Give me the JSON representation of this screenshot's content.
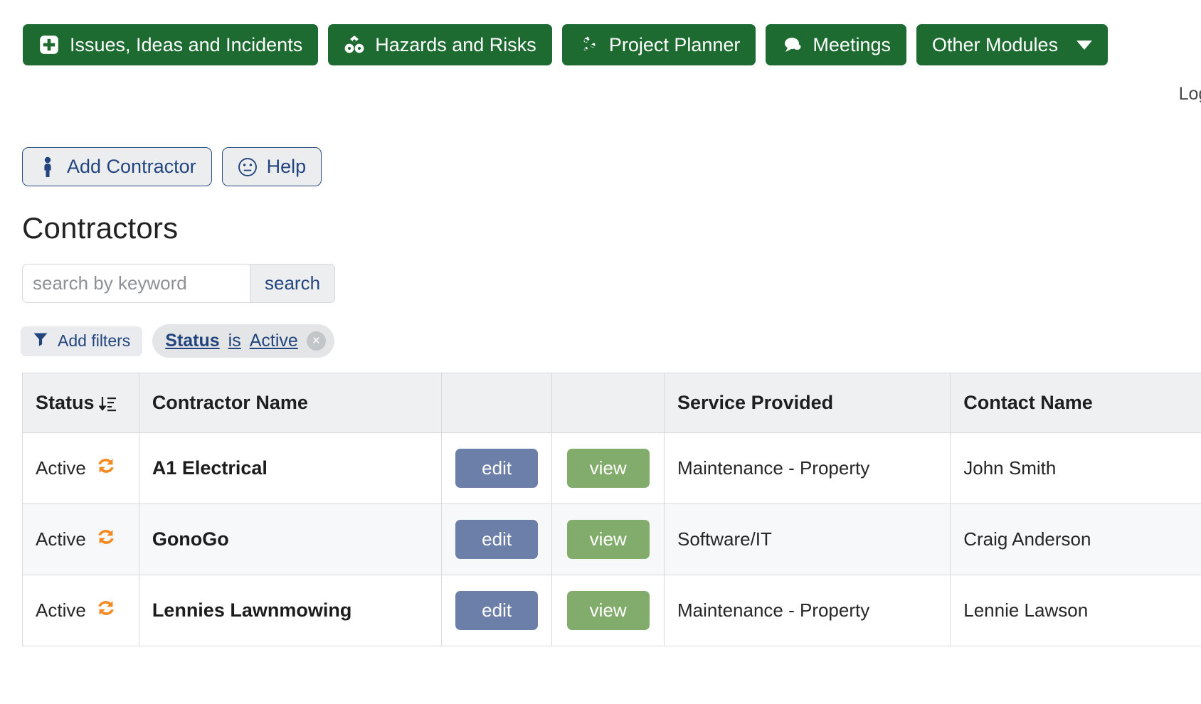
{
  "nav": {
    "items": [
      {
        "label": "Issues, Ideas and Incidents",
        "icon": "first-aid-plus-icon"
      },
      {
        "label": "Hazards and Risks",
        "icon": "hazard-blocks-icon"
      },
      {
        "label": "Project Planner",
        "icon": "gears-icon"
      },
      {
        "label": "Meetings",
        "icon": "speech-bubble-icon"
      },
      {
        "label": "Other Modules",
        "icon": "chevron-down-icon"
      }
    ],
    "background_color": "#1E6B32"
  },
  "header": {
    "logged_in_text": "Logged"
  },
  "toolbar": {
    "add_contractor_label": "Add Contractor",
    "add_contractor_icon": "person-icon",
    "help_label": "Help",
    "help_icon": "neutral-face-icon"
  },
  "page": {
    "title": "Contractors"
  },
  "search": {
    "placeholder": "search by keyword",
    "value": "",
    "button_label": "search"
  },
  "filters": {
    "add_filters_label": "Add filters",
    "add_filters_icon": "funnel-icon",
    "chips": [
      {
        "field": "Status",
        "operator": "is",
        "value": "Active",
        "remove_label": "×"
      }
    ]
  },
  "table": {
    "columns": [
      {
        "label": "Status",
        "sort_icon": "sort-descending-icon"
      },
      {
        "label": "Contractor Name"
      },
      {
        "label": ""
      },
      {
        "label": ""
      },
      {
        "label": "Service Provided"
      },
      {
        "label": "Contact Name"
      }
    ],
    "row_actions": {
      "edit_label": "edit",
      "view_label": "view",
      "edit_color": "#6B7FA8",
      "view_color": "#82AC6B"
    },
    "status_icon": "sync-arrows-icon",
    "status_icon_color": "#F5881F",
    "rows": [
      {
        "status": "Active",
        "name": "A1 Electrical",
        "service": "Maintenance - Property",
        "contact": "John Smith"
      },
      {
        "status": "Active",
        "name": "GonoGo",
        "service": "Software/IT",
        "contact": "Craig Anderson"
      },
      {
        "status": "Active",
        "name": "Lennies Lawnmowing",
        "service": "Maintenance - Property",
        "contact": "Lennie Lawson"
      }
    ]
  }
}
